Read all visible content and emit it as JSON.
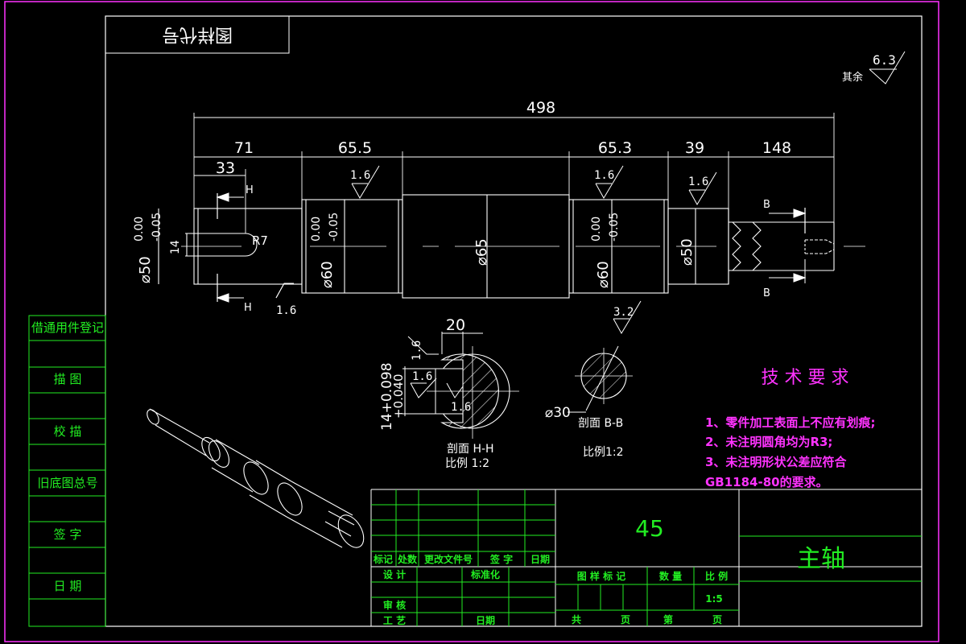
{
  "drawing_number_mirrored": "图样代号",
  "side_table": [
    "借通用件登记",
    "描 图",
    "校 描",
    "旧底图总号",
    "签 字",
    "日 期"
  ],
  "roughness": {
    "other_label": "其余",
    "other_value": "6.3",
    "fine": "1.6",
    "medium": "3.2"
  },
  "dimensions": {
    "total": "498",
    "d71": "71",
    "d655": "65.5",
    "d653": "65.3",
    "d39": "39",
    "d148": "148",
    "d33": "33",
    "dia50_left": "⌀50",
    "tol_upper": "0.00",
    "tol_lower": "-0.05",
    "key_width": "14",
    "radius": "R7",
    "dia60_left": "⌀60",
    "dia65": "⌀65",
    "dia60_right": "⌀60",
    "dia50_right": "⌀50",
    "section_h": "H",
    "section_b": "B",
    "keyway_20": "20",
    "keyway_tol": "14+0.098",
    "keyway_tol2": "+0.040",
    "dia30": "⌀30"
  },
  "sections": {
    "hh_title": "剖面 H-H",
    "hh_scale": "比例 1:2",
    "bb_title": "剖面 B-B",
    "bb_scale": "比例1:2"
  },
  "tech_req": {
    "title": "技 术 要 求",
    "items": [
      "1、零件加工表面上不应有划痕;",
      "2、未注明圆角均为R3;",
      "3、未注明形状公差应符合",
      "GB1184-80的要求。"
    ]
  },
  "title_block": {
    "material": "45",
    "part_name": "主轴",
    "rev_headers": [
      "标记",
      "处数",
      "更改文件号",
      "签 字",
      "日期"
    ],
    "design": "设 计",
    "standardize": "标准化",
    "review": "审 核",
    "process": "工 艺",
    "date": "日期",
    "stage_mark": "图 样 标 记",
    "quantity": "数 量",
    "scale_label": "比 例",
    "scale_value": "1:5",
    "total_sheets": "共",
    "sheet": "页",
    "sheet_no": "第",
    "sheet2": "页"
  }
}
